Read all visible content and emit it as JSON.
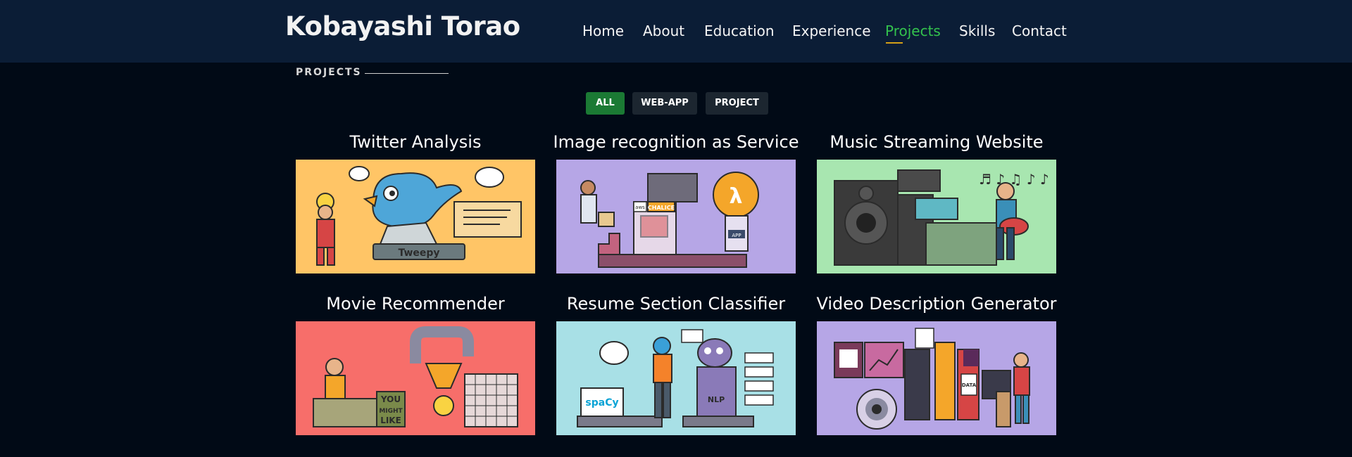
{
  "header": {
    "brand": "Kobayashi Torao",
    "nav": [
      "Home",
      "About",
      "Education",
      "Experience",
      "Projects",
      "Skills",
      "Contact"
    ],
    "active_nav": "Projects",
    "accent_color": "#33c24d"
  },
  "section": {
    "title": "PROJECTS"
  },
  "filters": {
    "all": "ALL",
    "web_app": "WEB-APP",
    "project": "PROJECT",
    "selected": "ALL"
  },
  "projects": [
    {
      "title": "Twitter Analysis",
      "bg": "#ffc566",
      "icon": "twitter-bird-illustration",
      "caption": "Tweepy"
    },
    {
      "title": "Image recognition as Service",
      "bg": "#b6a6e6",
      "icon": "aws-lambda-illustration",
      "caption": "CHALICE",
      "aws": "aws",
      "lambda": "λ",
      "app": "APP"
    },
    {
      "title": "Music Streaming Website",
      "bg": "#a8e6b0",
      "icon": "music-speaker-illustration",
      "notes": "♬ ♪ ♫ ♪ ♪"
    },
    {
      "title": "Movie Recommender",
      "bg": "#f76e6a",
      "icon": "movie-recommender-illustration",
      "you": "YOU",
      "might": "MIGHT",
      "like": "LIKE"
    },
    {
      "title": "Resume Section Classifier",
      "bg": "#a8e0e6",
      "icon": "nlp-robot-illustration",
      "spacy": "spaCy",
      "nlp": "NLP"
    },
    {
      "title": "Video Description Generator",
      "bg": "#b6a6e6",
      "icon": "video-data-illustration",
      "data": "DATA"
    }
  ]
}
